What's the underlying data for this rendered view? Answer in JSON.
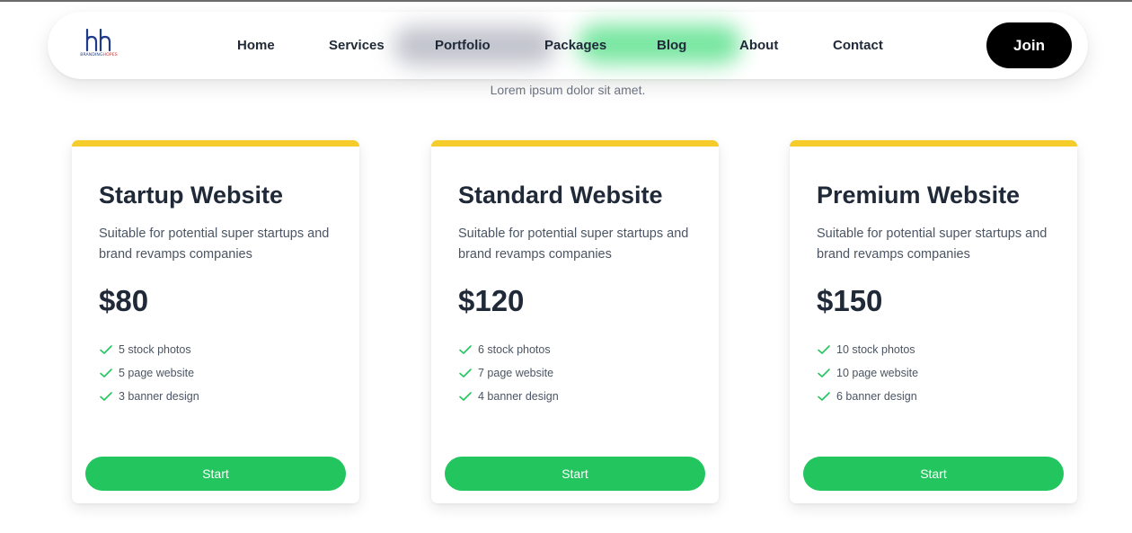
{
  "brand": {
    "mark": "bh",
    "text_main": "BRANDING",
    "text_accent": "HOPES"
  },
  "nav": {
    "links": [
      "Home",
      "Services",
      "Portfolio",
      "Packages",
      "Blog",
      "About",
      "Contact"
    ],
    "join_label": "Join"
  },
  "section": {
    "subtitle": "Lorem ipsum dolor sit amet."
  },
  "packages": [
    {
      "title": "Startup Website",
      "description": "Suitable for potential super startups and brand revamps companies",
      "price": "$80",
      "features": [
        "5 stock photos",
        "5 page website",
        "3 banner design"
      ],
      "button_label": "Start"
    },
    {
      "title": "Standard Website",
      "description": "Suitable for potential super startups and brand revamps companies",
      "price": "$120",
      "features": [
        "6 stock photos",
        "7 page website",
        "4 banner design"
      ],
      "button_label": "Start"
    },
    {
      "title": "Premium Website",
      "description": "Suitable for potential super startups and brand revamps companies",
      "price": "$150",
      "features": [
        "10 stock photos",
        "10 page website",
        "6 banner design"
      ],
      "button_label": "Start"
    }
  ],
  "colors": {
    "accent_bar": "#f5cc2a",
    "button_green": "#22c55e",
    "check_green": "#22c55e",
    "join_bg": "#000000"
  },
  "icons": {
    "feature_check": "check-icon"
  }
}
